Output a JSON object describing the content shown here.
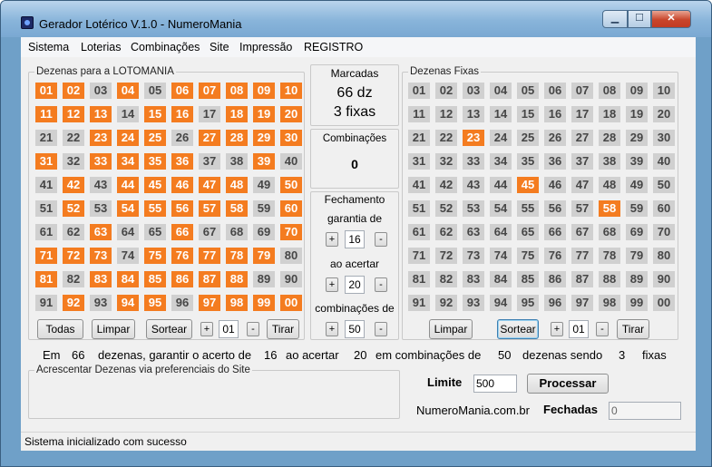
{
  "window": {
    "title": "Gerador Lotérico V.1.0 - NumeroMania"
  },
  "menu": [
    "Sistema",
    "Loterias",
    "Combinações",
    "Site",
    "Impressão",
    "REGISTRO"
  ],
  "left_panel": {
    "title": "Dezenas para a LOTOMANIA",
    "numbers": [
      "01",
      "02",
      "03",
      "04",
      "05",
      "06",
      "07",
      "08",
      "09",
      "10",
      "11",
      "12",
      "13",
      "14",
      "15",
      "16",
      "17",
      "18",
      "19",
      "20",
      "21",
      "22",
      "23",
      "24",
      "25",
      "26",
      "27",
      "28",
      "29",
      "30",
      "31",
      "32",
      "33",
      "34",
      "35",
      "36",
      "37",
      "38",
      "39",
      "40",
      "41",
      "42",
      "43",
      "44",
      "45",
      "46",
      "47",
      "48",
      "49",
      "50",
      "51",
      "52",
      "53",
      "54",
      "55",
      "56",
      "57",
      "58",
      "59",
      "60",
      "61",
      "62",
      "63",
      "64",
      "65",
      "66",
      "67",
      "68",
      "69",
      "70",
      "71",
      "72",
      "73",
      "74",
      "75",
      "76",
      "77",
      "78",
      "79",
      "80",
      "81",
      "82",
      "83",
      "84",
      "85",
      "86",
      "87",
      "88",
      "89",
      "90",
      "91",
      "92",
      "93",
      "94",
      "95",
      "96",
      "97",
      "98",
      "99",
      "00"
    ],
    "selected": [
      "01",
      "02",
      "04",
      "06",
      "07",
      "08",
      "09",
      "10",
      "11",
      "12",
      "13",
      "15",
      "16",
      "18",
      "19",
      "20",
      "23",
      "24",
      "25",
      "27",
      "28",
      "29",
      "30",
      "31",
      "33",
      "34",
      "35",
      "36",
      "39",
      "42",
      "44",
      "45",
      "46",
      "47",
      "48",
      "50",
      "52",
      "54",
      "55",
      "56",
      "57",
      "58",
      "60",
      "63",
      "66",
      "70",
      "71",
      "72",
      "73",
      "75",
      "76",
      "77",
      "78",
      "79",
      "81",
      "83",
      "84",
      "85",
      "86",
      "87",
      "88",
      "92",
      "94",
      "95",
      "97",
      "98",
      "99",
      "00"
    ],
    "buttons": {
      "todas": "Todas",
      "limpar": "Limpar",
      "sortear": "Sortear",
      "plus": "+",
      "minus": "-",
      "tirar": "Tirar"
    },
    "count_value": "01"
  },
  "middle": {
    "marcadas_label": "Marcadas",
    "dezenas_text": "66 dz",
    "fixas_text": "3 fixas",
    "combinacoes_label": "Combinações",
    "combinacoes_value": "0",
    "fechamento_label": "Fechamento",
    "garantia_label": "garantia de",
    "garantia_value": "16",
    "acertar_label": "ao acertar",
    "acertar_value": "20",
    "combinacoes_de_label": "combinações de",
    "combinacoes_de_value": "50",
    "plus": "+",
    "minus": "-"
  },
  "right_panel": {
    "title": "Dezenas Fixas",
    "selected": [
      "23",
      "45",
      "58"
    ],
    "buttons": {
      "limpar": "Limpar",
      "sortear": "Sortear",
      "plus": "+",
      "minus": "-",
      "tirar": "Tirar"
    },
    "count_value": "01"
  },
  "summary": {
    "words": [
      "Em",
      "66",
      "dezenas, garantir o acerto de",
      "16",
      "ao acertar",
      "20",
      "em combinações de",
      "50",
      "dezenas sendo",
      "3",
      "fixas"
    ]
  },
  "site_panel": {
    "title": "Acrescentar Dezenas via preferenciais do Site"
  },
  "bottom_right": {
    "limite_label": "Limite",
    "limite_value": "500",
    "processar": "Processar",
    "site_name": "NumeroMania.com.br",
    "fechadas_label": "Fechadas",
    "fechadas_value": "0"
  },
  "status": {
    "text": "Sistema inicializado com sucesso"
  },
  "colors": {
    "selected": "#f47c20",
    "unselected": "#d0d0d0",
    "titlebar": "#88b4da"
  }
}
